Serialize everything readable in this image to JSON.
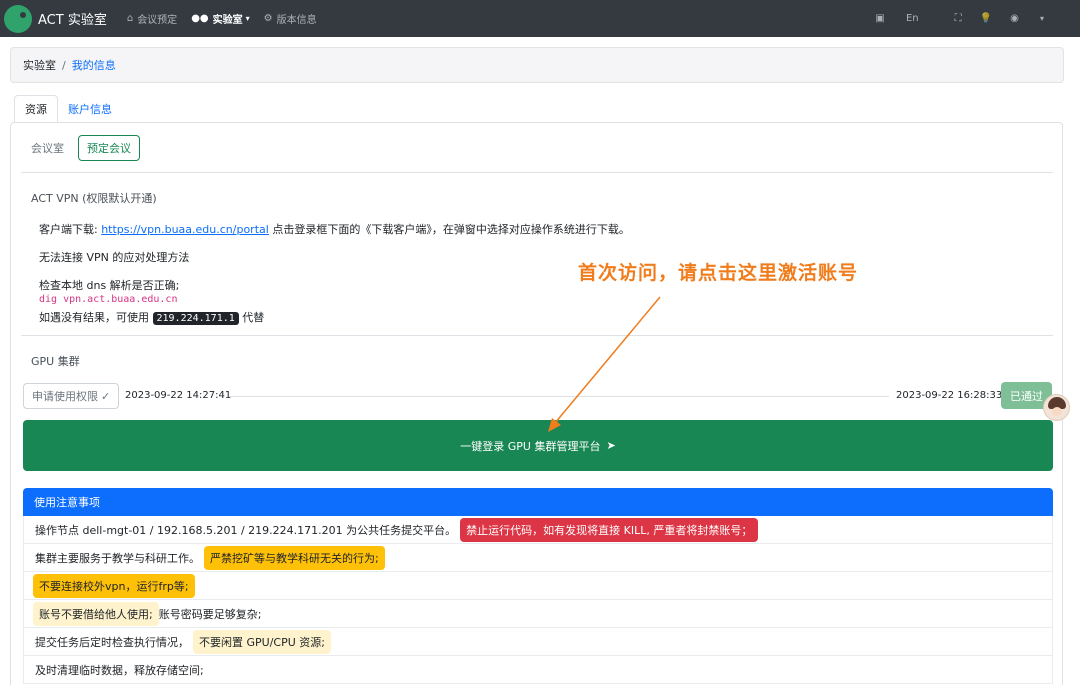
{
  "navbar": {
    "brand": "ACT 实验室",
    "items": [
      {
        "label": "会议预定",
        "icon": "building-icon"
      },
      {
        "label": "实验室",
        "icon": "users-icon"
      },
      {
        "label": "版本信息",
        "icon": "cogs-icon"
      }
    ],
    "lang": "En",
    "lang_icon": "language-icon",
    "fullscreen_icon": "expand-icon",
    "theme_icon": "lightbulb-icon",
    "user_icon": "user-circle-icon"
  },
  "breadcrumb": {
    "root": "实验室",
    "current": "我的信息"
  },
  "tabs": [
    "资源",
    "账户信息"
  ],
  "meeting": {
    "label": "会议室",
    "button": "预定会议"
  },
  "vpn": {
    "title": "ACT VPN (权限默认开通)",
    "download_prefix": "客户端下载: ",
    "download_link": "https://vpn.buaa.edu.cn/portal",
    "download_suffix": " 点击登录框下面的《下载客户端》，在弹窗中选择对应操作系统进行下载。",
    "cannot_connect": "无法连接 VPN 的应对处理方法",
    "dns_check": "检查本地 dns 解析是否正确;",
    "dig_cmd": "dig vpn.act.buaa.edu.cn",
    "fallback_prefix": "如遇没有结果，可使用 ",
    "fallback_ip": "219.224.171.1",
    "fallback_suffix": " 代替"
  },
  "gpu": {
    "title": "GPU 集群",
    "request_button": "申请使用权限",
    "request_time": "2023-09-22 14:27:41",
    "approve_time": "2023-09-22 16:28:33",
    "status": "已通过",
    "login_button": "一键登录 GPU 集群管理平台"
  },
  "annotation": "首次访问，请点击这里激活账号",
  "notice": {
    "title": "使用注意事项",
    "rows": [
      {
        "text": "操作节点 dell-mgt-01 / 192.168.5.201 / 219.224.171.201 为公共任务提交平台。",
        "badge": "禁止运行代码，如有发现将直接 KILL, 严重者将封禁账号；",
        "badge_type": "danger"
      },
      {
        "text": "集群主要服务于教学与科研工作。",
        "badge": "严禁挖矿等与教学科研无关的行为;",
        "badge_type": "warning"
      },
      {
        "text": "",
        "badge": "不要连接校外vpn，运行frp等;",
        "badge_type": "warning"
      },
      {
        "pre_badge": "账号不要借给他人使用;",
        "text": " 账号密码要足够复杂;"
      },
      {
        "text": "提交任务后定时检查执行情况，",
        "badge": "不要闲置 GPU/CPU 资源;",
        "badge_type": "warning-light"
      },
      {
        "text": "及时清理临时数据，释放存储空间;"
      }
    ]
  }
}
